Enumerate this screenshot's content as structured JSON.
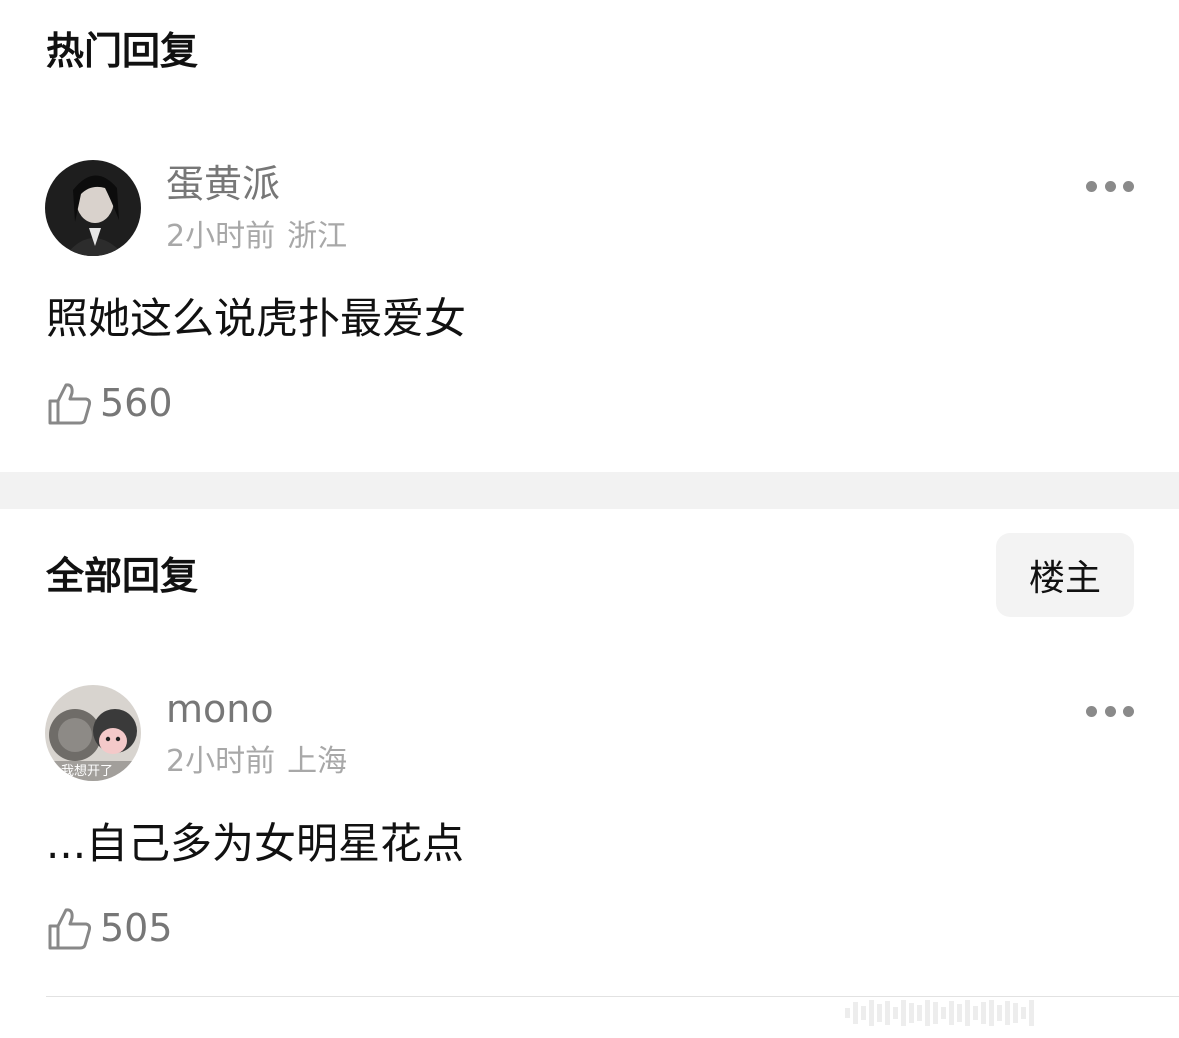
{
  "sections": {
    "hot_title": "热门回复",
    "all_title": "全部回复",
    "op_button": "楼主"
  },
  "comments": [
    {
      "username": "蛋黄派",
      "time": "2小时前",
      "location": "浙江",
      "text": "照她这么说虎扑最爱女",
      "likes": "560",
      "avatar_icon": "user-avatar-photo"
    },
    {
      "username": "mono",
      "time": "2小时前",
      "location": "上海",
      "text": "...自己多为女明星花点",
      "likes": "505",
      "avatar_icon": "user-avatar-photo",
      "avatar_caption": "我想开了"
    }
  ],
  "colors": {
    "accent_text": "#111111",
    "secondary_text": "#777777",
    "meta_text": "#a8a8a8",
    "band": "#f2f2f2"
  }
}
